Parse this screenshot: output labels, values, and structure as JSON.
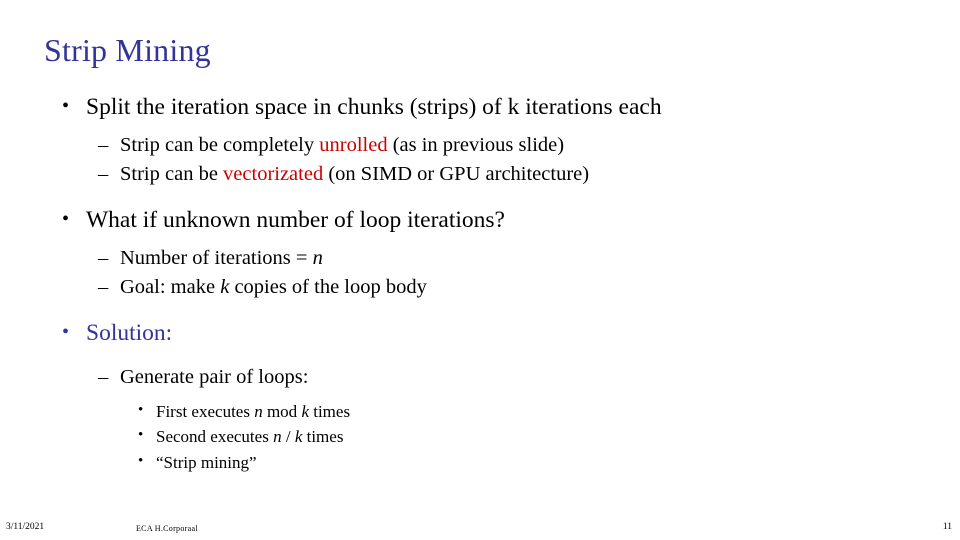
{
  "slide": {
    "title": "Strip Mining",
    "bullets": {
      "b1": "Split the iteration space in chunks (strips) of k iterations each",
      "b1s1_a": "Strip can be completely ",
      "b1s1_red": "unrolled",
      "b1s1_b": " (as in previous slide)",
      "b1s2_a": "Strip can be ",
      "b1s2_red": "vectorizated",
      "b1s2_b": " (on SIMD or GPU architecture)",
      "b2": "What if unknown number of loop iterations?",
      "b2s1_a": "Number of iterations = ",
      "b2s1_i": "n",
      "b2s2_a": "Goal:  make ",
      "b2s2_i": "k",
      "b2s2_b": " copies of the loop body",
      "b3_a": "Solution",
      "b3_b": ":",
      "b3s1": "Generate pair of loops:",
      "b3s1a_a": "First executes ",
      "b3s1a_i1": "n",
      "b3s1a_b": " mod ",
      "b3s1a_i2": "k",
      "b3s1a_c": " times",
      "b3s1b_a": "Second executes ",
      "b3s1b_i1": "n",
      "b3s1b_b": " / ",
      "b3s1b_i2": "k",
      "b3s1b_c": " times",
      "b3s1c": "“Strip mining”"
    },
    "marks": {
      "bullet_glyph": "•",
      "dash_glyph": "–"
    },
    "footer": {
      "date": "3/11/2021",
      "center": "ECA  H.Corporaal",
      "page": "11"
    },
    "colors": {
      "title": "#333399",
      "accent_red": "#cc0000",
      "solution_blue": "#333399"
    }
  }
}
